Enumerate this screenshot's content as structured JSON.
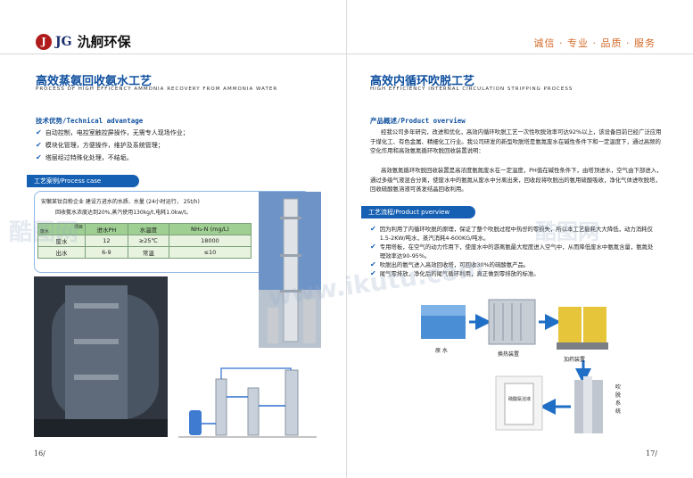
{
  "brand": {
    "mark": "J",
    "abbr": "JG",
    "name": "氿舸环保"
  },
  "slogan": "诚信 · 专业 · 品质 · 服务",
  "left": {
    "title": "高效蒸氨回收氨水工艺",
    "title_en": "PROCESS OF HIGH EFFICENCY AMMONIA RECOVERY FROM AMMONIA WATER",
    "advantage_heading": "技术优势/Technical advantage",
    "advantages": [
      "自动控制，电控室触控屏操作，无需专人现场作业；",
      "模块化管理，方便操作，维护及系统管理；",
      "塔层经过特殊化处理，不结垢。"
    ],
    "case_tag": "工艺案例/Process case",
    "case_line1": "安徽某钛白粉企业        建设方进水的水质、水量  (24小时运行， 25t/h)",
    "case_line2": "回收氨水浓度达到20%,蒸汽使用130kg/t,电耗1.0kw/t。",
    "table": {
      "corner_top": "项目",
      "corner_bottom": "废水",
      "headers": [
        "进水PH",
        "水温度",
        "NH₃-N (mg/L)"
      ],
      "rows": [
        {
          "label": "废水",
          "cells": [
            "12",
            "≥25℃",
            "18000"
          ]
        },
        {
          "label": "出水",
          "cells": [
            "6-9",
            "常温",
            "≤10"
          ]
        }
      ]
    },
    "page_number": "16/"
  },
  "right": {
    "title": "高效内循环吹脱工艺",
    "title_en": "HIGH EFFICIENCY INTERNAL CIRCULATION STRIPPING PROCESS",
    "overview_heading": "产品概述/Product overview",
    "overview_p1": "经我公司多年研究，改进和优化，高效内循环吹脱工艺一次性吹脱效率可达92%以上，该设备目前已经广泛应用于煤化工、有色金属、精细化工行业。我公司研发的新型吹脱塔是氨氮废水在碱性条件下和一定温度下，通过高频的空化作用和高效氨氮循环吹脱回收装置说明：",
    "overview_p2": "高效氨氮循环吹脱回收装置是高浓度氨氮废水在一定温度，PH值在碱性条件下，由塔顶进水，空气由下部进入，通过多级气液混合分离，使废水中的氨氮从废水中分离出来，回收段将吹脱出的氨用硫酸吸收，净化气体进吹脱塔，回收硫酸氨溶液可蒸发结晶回收利用。",
    "process_tag": "工艺流程/Product pverview",
    "process_points": [
      "因为利用了内循环吹脱的原理，保证了整个吹脱过程中热량的零损失，所以本工艺能耗大大降低，动力消耗仅1.5-2KW/吨水，蒸汽消耗4-600KG/吨水。",
      "专用塔板，在空气的动力作用下，使废水中的游离氨最大程度进入空气中，从而降低废水中氨氮含量，氨氮处理效率达90-95%。",
      "吹脱出的氨气进入高效回收塔，可回收30%的硫酸氨产品。",
      "尾气零排放，净化后的尾气循环利用，真正做到零排放的标准。"
    ],
    "diagram_labels": {
      "raw_water": "原 水",
      "heat_exchanger": "换热装置",
      "dosing": "加药装置",
      "product": "硫酸氨溶液",
      "stripping": "吹脱系统"
    },
    "page_number": "17/"
  },
  "watermark": "www.ikutu.com",
  "watermark_cn": "酷图网"
}
